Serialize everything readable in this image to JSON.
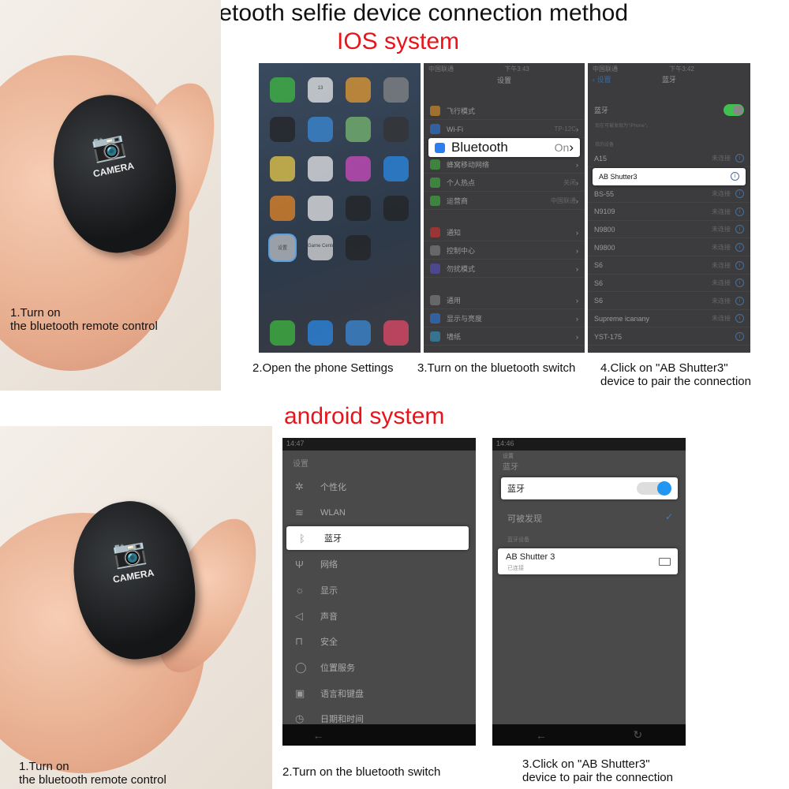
{
  "title": "Bluetooth selfie device connection method",
  "ios": {
    "heading": "IOS system",
    "step1": "1.Turn on\nthe bluetooth remote control",
    "step2": "2.Open the phone Settings",
    "step3": "3.Turn on the bluetooth switch",
    "step4": "4.Click on \"AB Shutter3\"\ndevice to pair the connection",
    "remote_label": "CAMERA",
    "home": {
      "icons": [
        {
          "name": "messages-icon",
          "color": "#3fc03f"
        },
        {
          "name": "calendar-icon",
          "color": "#f5f5f5",
          "label": "13"
        },
        {
          "name": "photos-icon",
          "color": "#f0a030"
        },
        {
          "name": "camera-icon",
          "color": "#8a8a8a"
        },
        {
          "name": "clock-icon",
          "color": "#222222"
        },
        {
          "name": "weather-icon",
          "color": "#3a8ee0"
        },
        {
          "name": "maps-icon",
          "color": "#7cc070"
        },
        {
          "name": "videos-icon",
          "color": "#333333"
        },
        {
          "name": "notes-icon",
          "color": "#f4d34a"
        },
        {
          "name": "reminders-icon",
          "color": "#f5f5f5"
        },
        {
          "name": "itunes-icon",
          "color": "#d94cc6"
        },
        {
          "name": "appstore-icon",
          "color": "#2a8ef0"
        },
        {
          "name": "ibooks-icon",
          "color": "#f08a24"
        },
        {
          "name": "health-icon",
          "color": "#f5f5f5"
        },
        {
          "name": "watch-icon",
          "color": "#222222"
        },
        {
          "name": "wallet-icon",
          "color": "#222222"
        },
        {
          "name": "settings-icon",
          "color": "#9aa0a8",
          "label": "设置"
        },
        {
          "name": "game-center-icon",
          "color": "#e8e8e8",
          "label": "Game Center"
        },
        {
          "name": "stocks-icon",
          "color": "#222222"
        }
      ],
      "dock": [
        {
          "name": "phone-icon",
          "color": "#3fc03f"
        },
        {
          "name": "mail-icon",
          "color": "#2a8ef0"
        },
        {
          "name": "safari-icon",
          "color": "#3a8ee0"
        },
        {
          "name": "music-icon",
          "color": "#f04a6a"
        }
      ]
    },
    "settings": {
      "status_time": "下午3:43",
      "carrier": "中国联通",
      "title": "设置",
      "rows": [
        {
          "label": "飞行模式",
          "icon": "airplane-icon",
          "color": "#f09a20",
          "value": ""
        },
        {
          "label": "Wi-Fi",
          "icon": "wifi-icon",
          "color": "#2a7ef0",
          "value": "TP-12C"
        },
        {
          "label": "Bluetooth",
          "icon": "bluetooth-icon",
          "color": "#2a7ef0",
          "value": "On",
          "highlight": true
        },
        {
          "label": "蜂窝移动网络",
          "icon": "cellular-icon",
          "color": "#3fc03f",
          "value": ""
        },
        {
          "label": "个人热点",
          "icon": "hotspot-icon",
          "color": "#3fc03f",
          "value": "关闭"
        },
        {
          "label": "运营商",
          "icon": "carrier-icon",
          "color": "#3fc03f",
          "value": "中国联通"
        },
        {
          "label": "通知",
          "icon": "notifications-icon",
          "color": "#e83030",
          "value": ""
        },
        {
          "label": "控制中心",
          "icon": "control-center-icon",
          "color": "#8a8a8a",
          "value": ""
        },
        {
          "label": "勿扰模式",
          "icon": "do-not-disturb-icon",
          "color": "#5a50d0",
          "value": ""
        },
        {
          "label": "通用",
          "icon": "general-icon",
          "color": "#8a8a8a",
          "value": ""
        },
        {
          "label": "显示与亮度",
          "icon": "display-icon",
          "color": "#2a7ef0",
          "value": ""
        },
        {
          "label": "墙纸",
          "icon": "wallpaper-icon",
          "color": "#30a0d0",
          "value": ""
        }
      ]
    },
    "bluetooth": {
      "status_time": "下午3:42",
      "carrier": "中国联通",
      "back": "设置",
      "title": "蓝牙",
      "toggle_label": "蓝牙",
      "toggle_on": true,
      "toggle_color": "#3fc050",
      "discoverable": "现在可被发现为\"iPhone\"。",
      "section": "我的设备",
      "devices": [
        {
          "name": "A15",
          "status": "未连接"
        },
        {
          "name": "AB Shutter3",
          "status": "",
          "highlight": true
        },
        {
          "name": "BS-55",
          "status": "未连接"
        },
        {
          "name": "N9109",
          "status": "未连接"
        },
        {
          "name": "N9800",
          "status": "未连接"
        },
        {
          "name": "N9800",
          "status": "未连接"
        },
        {
          "name": "S6",
          "status": "未连接"
        },
        {
          "name": "S6",
          "status": "未连接"
        },
        {
          "name": "S6",
          "status": "未连接"
        },
        {
          "name": "Supreme icanany",
          "status": "未连接"
        },
        {
          "name": "YST-175",
          "status": ""
        }
      ]
    }
  },
  "android": {
    "heading": "android system",
    "step1": "1.Turn on\nthe bluetooth remote control",
    "step2": "2.Turn on the bluetooth switch",
    "step3": "3.Click on \"AB Shutter3\"\ndevice to pair the connection",
    "remote_label": "CAMERA",
    "settings": {
      "status_time": "14:47",
      "title": "设置",
      "items": [
        {
          "label": "个性化",
          "icon": "personalize-icon",
          "glyph": "✲"
        },
        {
          "label": "WLAN",
          "icon": "wifi-icon",
          "glyph": "≋"
        },
        {
          "label": "蓝牙",
          "icon": "bluetooth-icon",
          "glyph": "ᛒ",
          "highlight": true
        },
        {
          "label": "网络",
          "icon": "antenna-icon",
          "glyph": "Ψ"
        },
        {
          "label": "显示",
          "icon": "brightness-icon",
          "glyph": "☼"
        },
        {
          "label": "声音",
          "icon": "speaker-icon",
          "glyph": "◁"
        },
        {
          "label": "安全",
          "icon": "lock-icon",
          "glyph": "⊓"
        },
        {
          "label": "位置服务",
          "icon": "location-icon",
          "glyph": "◯"
        },
        {
          "label": "语言和键盘",
          "icon": "keyboard-icon",
          "glyph": "▣"
        },
        {
          "label": "日期和时间",
          "icon": "clock-icon",
          "glyph": "◷"
        }
      ]
    },
    "bluetooth": {
      "status_time": "14:46",
      "parent": "设置",
      "title": "蓝牙",
      "toggle_label": "蓝牙",
      "toggle_on": true,
      "toggle_color": "#2196f3",
      "discoverable_label": "可被发现",
      "discoverable_checked": true,
      "section": "蓝牙设备",
      "device_name": "AB Shutter 3",
      "device_status": "已连接"
    }
  }
}
